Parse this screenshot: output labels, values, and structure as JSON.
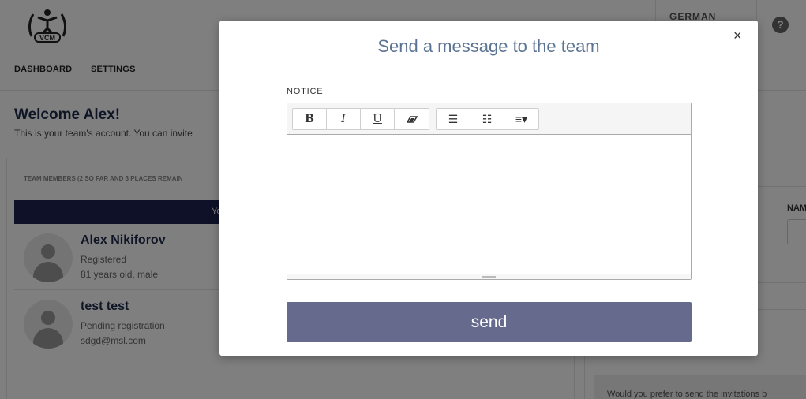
{
  "header": {
    "language": "GERMAN",
    "help_symbol": "?",
    "logo_text": "VCM"
  },
  "nav": {
    "items": [
      {
        "label": "DASHBOARD"
      },
      {
        "label": "SETTINGS"
      }
    ]
  },
  "welcome": {
    "title": "Welcome Alex!",
    "text": "This is your team's account. You can invite"
  },
  "team": {
    "header": "TEAM MEMBERS (2 SO FAR AND 3 PLACES REMAIN",
    "bar_text": "You h",
    "members": [
      {
        "name": "Alex Nikiforov",
        "line1": "Registered",
        "line2": "81 years old, male"
      },
      {
        "name": "test test",
        "line1": "Pending registration",
        "line2": "sdgd@msl.com"
      }
    ]
  },
  "right_panel": {
    "name_label": "NAM",
    "prefer_text": "Would you prefer to send the invitations b"
  },
  "modal": {
    "title": "Send a message to the team",
    "close_symbol": "×",
    "notice_label": "NOTICE",
    "toolbar": {
      "bold": "B",
      "italic": "I",
      "underline": "U",
      "unordered_list": "☰",
      "ordered_list": "☷",
      "align": "≡▾"
    },
    "editor_value": "",
    "send_label": "send"
  },
  "colors": {
    "navy": "#1c2350",
    "title_blue": "#5c7493",
    "send_button": "#666a8c"
  }
}
